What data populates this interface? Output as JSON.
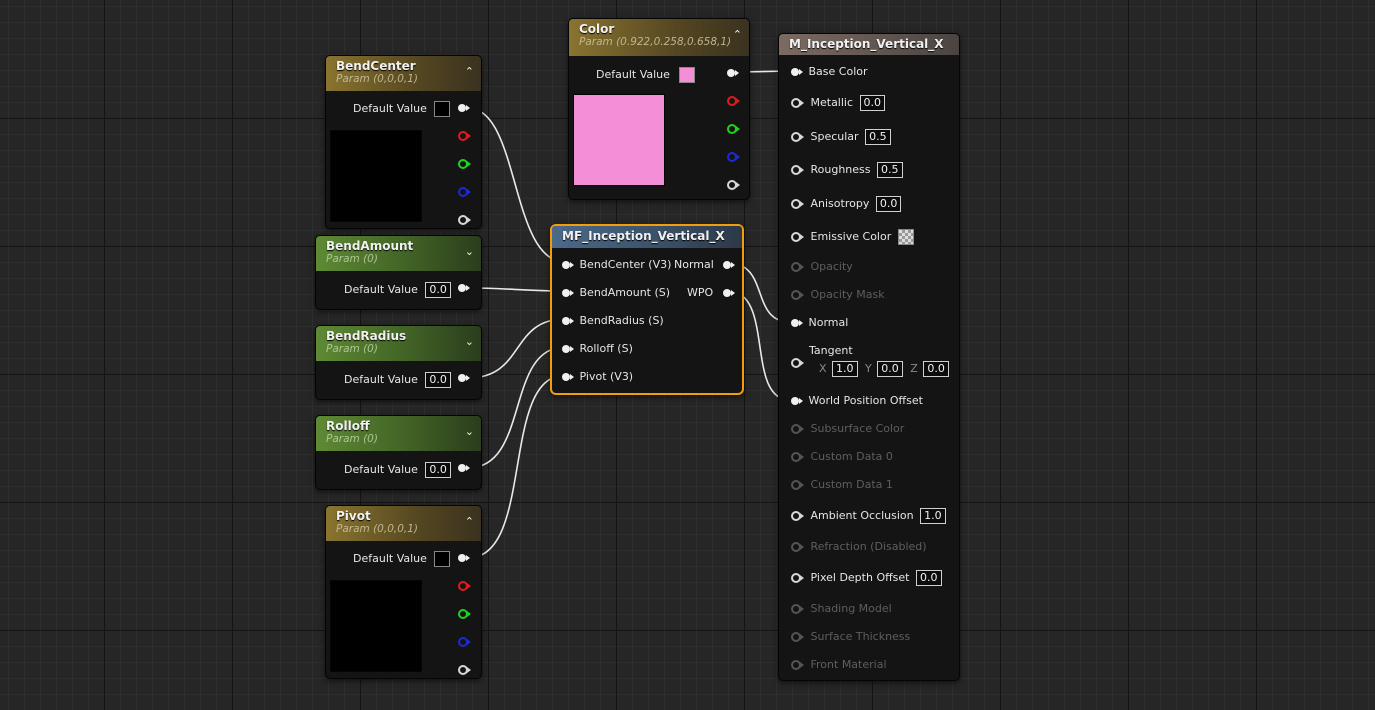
{
  "nodes": {
    "color": {
      "title": "Color",
      "subtitle": "Param (0.922,0.258,0.658,1)",
      "default_label": "Default Value",
      "swatch_color": "#f48ed6"
    },
    "bend_center": {
      "title": "BendCenter",
      "subtitle": "Param (0,0,0,1)",
      "default_label": "Default Value",
      "swatch_color": "#000000"
    },
    "bend_amount": {
      "title": "BendAmount",
      "subtitle": "Param (0)",
      "default_label": "Default Value",
      "value": "0.0"
    },
    "bend_radius": {
      "title": "BendRadius",
      "subtitle": "Param (0)",
      "default_label": "Default Value",
      "value": "0.0"
    },
    "rolloff": {
      "title": "Rolloff",
      "subtitle": "Param (0)",
      "default_label": "Default Value",
      "value": "0.0"
    },
    "pivot": {
      "title": "Pivot",
      "subtitle": "Param (0,0,0,1)",
      "default_label": "Default Value",
      "swatch_color": "#000000"
    },
    "function": {
      "title": "MF_Inception_Vertical_X",
      "inputs": [
        "BendCenter (V3)",
        "BendAmount (S)",
        "BendRadius (S)",
        "Rolloff (S)",
        "Pivot (V3)"
      ],
      "outputs": [
        "Normal",
        "WPO"
      ]
    },
    "material": {
      "title": "M_Inception_Vertical_X",
      "base_color": "Base Color",
      "metallic": {
        "label": "Metallic",
        "value": "0.0"
      },
      "specular": {
        "label": "Specular",
        "value": "0.5"
      },
      "roughness": {
        "label": "Roughness",
        "value": "0.5"
      },
      "anisotropy": {
        "label": "Anisotropy",
        "value": "0.0"
      },
      "emissive": "Emissive Color",
      "opacity": "Opacity",
      "opacity_mask": "Opacity Mask",
      "normal": "Normal",
      "tangent": {
        "label": "Tangent",
        "x_label": "X",
        "x": "1.0",
        "y_label": "Y",
        "y": "0.0",
        "z_label": "Z",
        "z": "0.0"
      },
      "wpo": "World Position Offset",
      "subsurface": "Subsurface Color",
      "custom0": "Custom Data 0",
      "custom1": "Custom Data 1",
      "ao": {
        "label": "Ambient Occlusion",
        "value": "1.0"
      },
      "refraction": "Refraction (Disabled)",
      "pdo": {
        "label": "Pixel Depth Offset",
        "value": "0.0"
      },
      "shading_model": "Shading Model",
      "surface_thickness": "Surface Thickness",
      "front_material": "Front Material"
    }
  },
  "colors": {
    "wire": "#e8e8e8",
    "selection": "#f29d0c",
    "pink": "#f48ed6"
  }
}
